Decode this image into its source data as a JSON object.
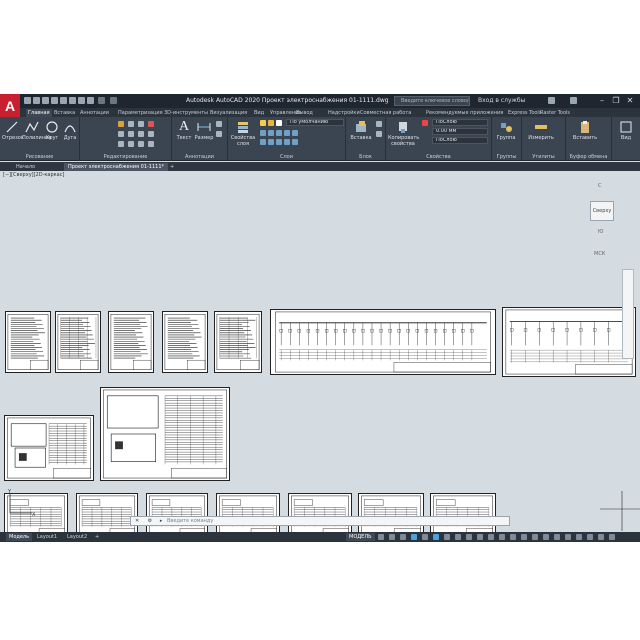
{
  "app": {
    "logo": "A",
    "title": "Autodesk AutoCAD 2020   Проект электроснабжения 01-1111.dwg",
    "search_placeholder": "Введите ключевое слово/фразу",
    "user": "Вход в службы"
  },
  "ribbon_tabs": [
    "Главная",
    "Вставка",
    "Аннотации",
    "Параметризация",
    "3D-инструменты",
    "Визуализация",
    "Вид",
    "Управление",
    "Вывод",
    "Надстройки",
    "Совместная работа",
    "Рекомендуемые приложения",
    "Express Tools",
    "Raster Tools"
  ],
  "ribbon": {
    "draw": {
      "title": "Рисование",
      "line": "Отрезок",
      "polyline": "Полилиния",
      "circle": "Круг",
      "arc": "Дуга"
    },
    "modify": {
      "title": "Редактирование"
    },
    "annotation": {
      "title": "Аннотации",
      "text": "Текст",
      "dimension": "Размер"
    },
    "layers": {
      "title": "Слои",
      "layer_props": "Свойства слоя",
      "current_layer": "По умолчанию"
    },
    "block": {
      "title": "Блок",
      "insert": "Вставка"
    },
    "properties": {
      "title": "Свойства",
      "match": "Копировать свойства",
      "color": "ПоСлою",
      "lineweight": "0.00 мм",
      "linetype": "ПоСлою"
    },
    "groups": {
      "title": "Группы",
      "group": "Группа"
    },
    "utilities": {
      "title": "Утилиты",
      "measure": "Измерить"
    },
    "clipboard": {
      "title": "Буфер обмена",
      "paste": "Вставить"
    },
    "view": {
      "title": "Вид"
    }
  },
  "doc_tabs": [
    "Начало",
    "Проект электроснабжения 01-1111*"
  ],
  "viewport_label": "[−][Сверху][2D-каркас]",
  "viewcube": {
    "top": "Сверху",
    "north": "С",
    "south": "Ю",
    "wcs": "МСК"
  },
  "command_placeholder": "Введите команду",
  "layout_tabs": [
    "Модель",
    "Layout1",
    "Layout2"
  ],
  "status": {
    "model_label": "МОДЕЛЬ"
  },
  "colors": {
    "bg_canvas": "#d4dce1",
    "ribbon": "#3b4451",
    "titlebar": "#1f2630",
    "logo": "#c8202f",
    "accent": "#4aa3df"
  }
}
